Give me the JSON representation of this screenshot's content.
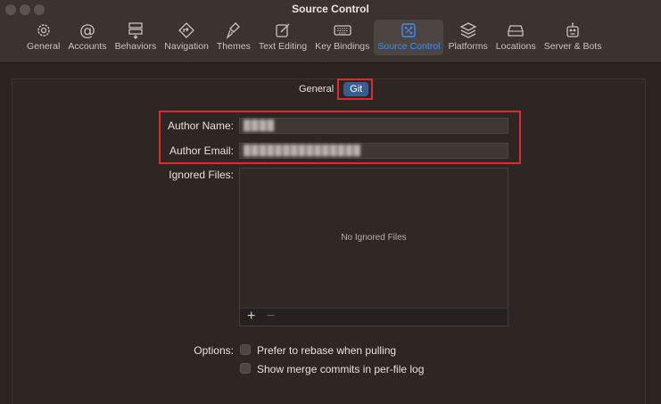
{
  "window": {
    "title": "Source Control"
  },
  "toolbar": {
    "items": [
      {
        "label": "General",
        "icon": "gear-icon"
      },
      {
        "label": "Accounts",
        "icon": "at-icon"
      },
      {
        "label": "Behaviors",
        "icon": "behaviors-icon"
      },
      {
        "label": "Navigation",
        "icon": "navigation-icon"
      },
      {
        "label": "Themes",
        "icon": "brush-icon"
      },
      {
        "label": "Text Editing",
        "icon": "edit-icon"
      },
      {
        "label": "Key Bindings",
        "icon": "keyboard-icon"
      },
      {
        "label": "Source Control",
        "icon": "source-control-icon",
        "active": true
      },
      {
        "label": "Platforms",
        "icon": "layers-icon"
      },
      {
        "label": "Locations",
        "icon": "drive-icon"
      },
      {
        "label": "Server & Bots",
        "icon": "robot-icon"
      }
    ]
  },
  "tabs": {
    "general": "General",
    "git": "Git",
    "selected": "Git"
  },
  "author": {
    "name_label": "Author Name:",
    "name_value": "████",
    "email_label": "Author Email:",
    "email_value": "███████████████"
  },
  "ignored": {
    "label": "Ignored Files:",
    "empty_text": "No Ignored Files",
    "add": "+",
    "remove": "−"
  },
  "options": {
    "label": "Options:",
    "rebase": "Prefer to rebase when pulling",
    "rebase_checked": false,
    "merge": "Show merge commits in per-file log",
    "merge_checked": false
  },
  "colors": {
    "accent": "#3d8df5",
    "highlight": "#e0282f",
    "segment_selected": "#355f8f"
  }
}
